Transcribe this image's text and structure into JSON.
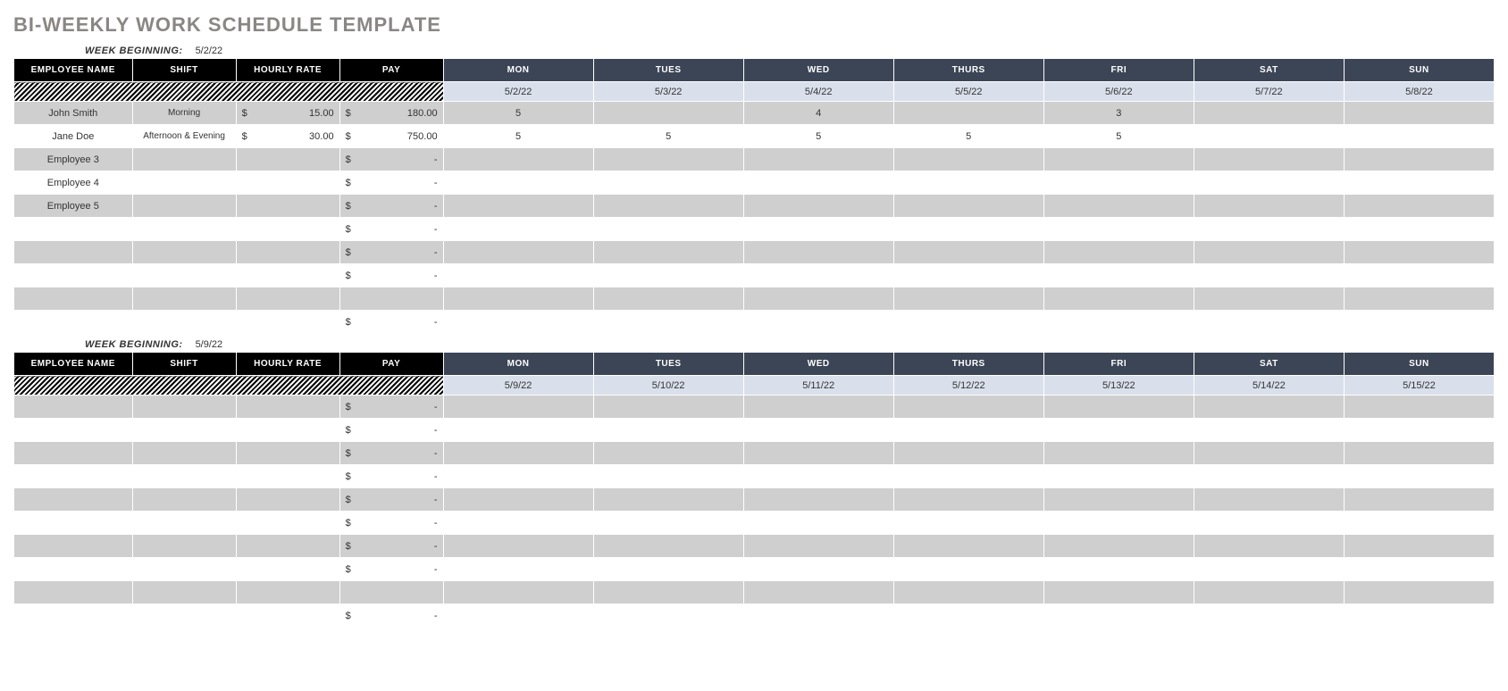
{
  "title": "BI-WEEKLY WORK SCHEDULE TEMPLATE",
  "week_begin_label": "WEEK BEGINNING:",
  "headers": {
    "left": [
      "EMPLOYEE NAME",
      "SHIFT",
      "HOURLY RATE",
      "PAY"
    ],
    "days": [
      "MON",
      "TUES",
      "WED",
      "THURS",
      "FRI",
      "SAT",
      "SUN"
    ]
  },
  "weeks": [
    {
      "beginning": "5/2/22",
      "dates": [
        "5/2/22",
        "5/3/22",
        "5/4/22",
        "5/5/22",
        "5/6/22",
        "5/7/22",
        "5/8/22"
      ],
      "rows": [
        {
          "employee": "John Smith",
          "shift": "Morning",
          "rate": "15.00",
          "pay": "180.00",
          "days": [
            "5",
            "",
            "4",
            "",
            "3",
            "",
            ""
          ]
        },
        {
          "employee": "Jane Doe",
          "shift": "Afternoon & Evening",
          "rate": "30.00",
          "pay": "750.00",
          "days": [
            "5",
            "5",
            "5",
            "5",
            "5",
            "",
            ""
          ]
        },
        {
          "employee": "Employee 3",
          "shift": "",
          "rate": "",
          "pay": "-",
          "days": [
            "",
            "",
            "",
            "",
            "",
            "",
            ""
          ]
        },
        {
          "employee": "Employee 4",
          "shift": "",
          "rate": "",
          "pay": "-",
          "days": [
            "",
            "",
            "",
            "",
            "",
            "",
            ""
          ]
        },
        {
          "employee": "Employee 5",
          "shift": "",
          "rate": "",
          "pay": "-",
          "days": [
            "",
            "",
            "",
            "",
            "",
            "",
            ""
          ]
        },
        {
          "employee": "",
          "shift": "",
          "rate": "",
          "pay": "-",
          "days": [
            "",
            "",
            "",
            "",
            "",
            "",
            ""
          ]
        },
        {
          "employee": "",
          "shift": "",
          "rate": "",
          "pay": "-",
          "days": [
            "",
            "",
            "",
            "",
            "",
            "",
            ""
          ]
        },
        {
          "employee": "",
          "shift": "",
          "rate": "",
          "pay": "-",
          "days": [
            "",
            "",
            "",
            "",
            "",
            "",
            ""
          ]
        },
        {
          "employee": "",
          "shift": "",
          "rate": "",
          "pay": "",
          "days": [
            "",
            "",
            "",
            "",
            "",
            "",
            ""
          ]
        },
        {
          "employee": "",
          "shift": "",
          "rate": "",
          "pay": "-",
          "days": [
            "",
            "",
            "",
            "",
            "",
            "",
            ""
          ]
        }
      ]
    },
    {
      "beginning": "5/9/22",
      "dates": [
        "5/9/22",
        "5/10/22",
        "5/11/22",
        "5/12/22",
        "5/13/22",
        "5/14/22",
        "5/15/22"
      ],
      "rows": [
        {
          "employee": "",
          "shift": "",
          "rate": "",
          "pay": "-",
          "days": [
            "",
            "",
            "",
            "",
            "",
            "",
            ""
          ]
        },
        {
          "employee": "",
          "shift": "",
          "rate": "",
          "pay": "-",
          "days": [
            "",
            "",
            "",
            "",
            "",
            "",
            ""
          ]
        },
        {
          "employee": "",
          "shift": "",
          "rate": "",
          "pay": "-",
          "days": [
            "",
            "",
            "",
            "",
            "",
            "",
            ""
          ]
        },
        {
          "employee": "",
          "shift": "",
          "rate": "",
          "pay": "-",
          "days": [
            "",
            "",
            "",
            "",
            "",
            "",
            ""
          ]
        },
        {
          "employee": "",
          "shift": "",
          "rate": "",
          "pay": "-",
          "days": [
            "",
            "",
            "",
            "",
            "",
            "",
            ""
          ]
        },
        {
          "employee": "",
          "shift": "",
          "rate": "",
          "pay": "-",
          "days": [
            "",
            "",
            "",
            "",
            "",
            "",
            ""
          ]
        },
        {
          "employee": "",
          "shift": "",
          "rate": "",
          "pay": "-",
          "days": [
            "",
            "",
            "",
            "",
            "",
            "",
            ""
          ]
        },
        {
          "employee": "",
          "shift": "",
          "rate": "",
          "pay": "-",
          "days": [
            "",
            "",
            "",
            "",
            "",
            "",
            ""
          ]
        },
        {
          "employee": "",
          "shift": "",
          "rate": "",
          "pay": "",
          "days": [
            "",
            "",
            "",
            "",
            "",
            "",
            ""
          ]
        },
        {
          "employee": "",
          "shift": "",
          "rate": "",
          "pay": "-",
          "days": [
            "",
            "",
            "",
            "",
            "",
            "",
            ""
          ]
        }
      ]
    }
  ],
  "currency_symbol": "$"
}
